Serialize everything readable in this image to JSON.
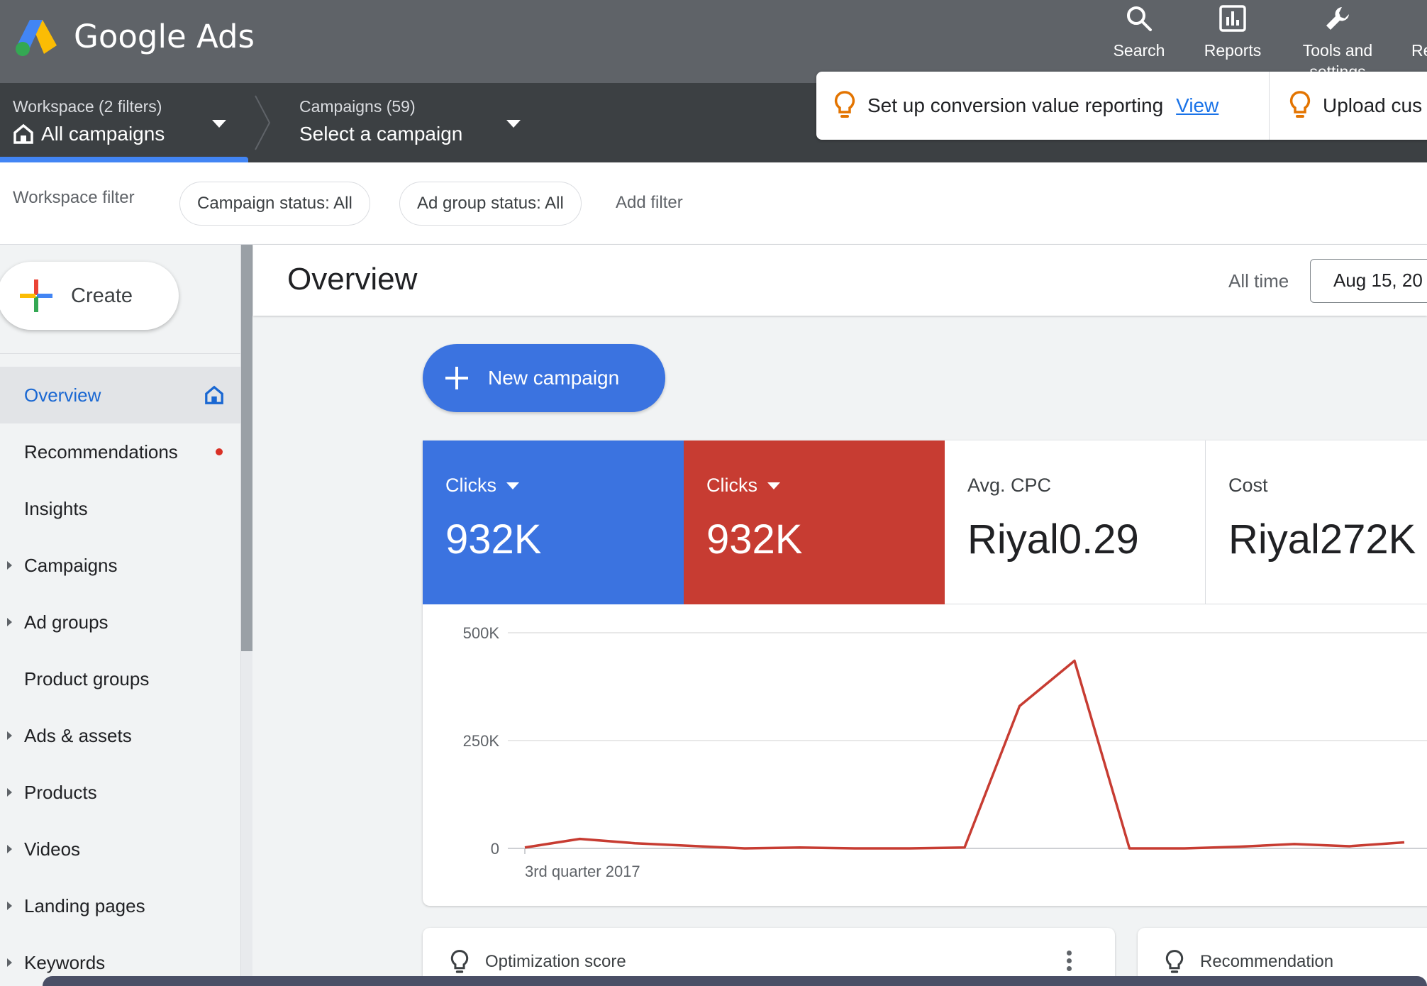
{
  "app": {
    "brand": "Google Ads",
    "colors": {
      "topbar": "#5f6368",
      "subbar": "#3c4043",
      "primary": "#3b73e0",
      "clicks_red": "#c73c32"
    }
  },
  "topnav": {
    "search": "Search",
    "reports": "Reports",
    "tools": "Tools and settings",
    "refresh_partial": "Re"
  },
  "breadcrumb": {
    "workspace_small": "Workspace (2 filters)",
    "workspace_big": "All campaigns",
    "campaigns_small": "Campaigns (59)",
    "campaigns_big": "Select a campaign"
  },
  "notifications": {
    "first_text": "Set up conversion value reporting",
    "first_link": "View",
    "second_text": "Upload cus"
  },
  "filters": {
    "label": "Workspace filter",
    "chips": [
      "Campaign status: All",
      "Ad group status: All"
    ],
    "add": "Add filter"
  },
  "sidebar": {
    "create_label": "Create",
    "items": [
      {
        "label": "Overview",
        "active": true,
        "icon": "home-icon"
      },
      {
        "label": "Recommendations",
        "dot": true
      },
      {
        "label": "Insights"
      },
      {
        "label": "Campaigns",
        "expandable": true
      },
      {
        "label": "Ad groups",
        "expandable": true
      },
      {
        "label": "Product groups"
      },
      {
        "label": "Ads & assets",
        "expandable": true
      },
      {
        "label": "Products",
        "expandable": true
      },
      {
        "label": "Videos",
        "expandable": true
      },
      {
        "label": "Landing pages",
        "expandable": true
      },
      {
        "label": "Keywords",
        "expandable": true
      }
    ]
  },
  "main": {
    "title": "Overview",
    "range_label": "All time",
    "date_value": "Aug 15, 20",
    "new_campaign": "New campaign"
  },
  "metrics": [
    {
      "label": "Clicks",
      "value": "932K",
      "dropdown": true
    },
    {
      "label": "Clicks",
      "value": "932K",
      "dropdown": true
    },
    {
      "label": "Avg. CPC",
      "value": "Riyal0.29"
    },
    {
      "label": "Cost",
      "value": "Riyal272K"
    }
  ],
  "chart_data": {
    "type": "line",
    "y_ticks": [
      "500K",
      "250K",
      "0"
    ],
    "ylim": [
      0,
      500000
    ],
    "x_first_label": "3rd quarter 2017",
    "grid": true,
    "series": [
      {
        "color": "#c73c32",
        "values": [
          2000,
          22000,
          12000,
          6000,
          0,
          2000,
          0,
          0,
          2000,
          330000,
          435000,
          0,
          0,
          4000,
          10000,
          5000,
          14000
        ]
      }
    ]
  },
  "bottom_cards": {
    "optimization": "Optimization score",
    "recommendation": "Recommendation"
  }
}
